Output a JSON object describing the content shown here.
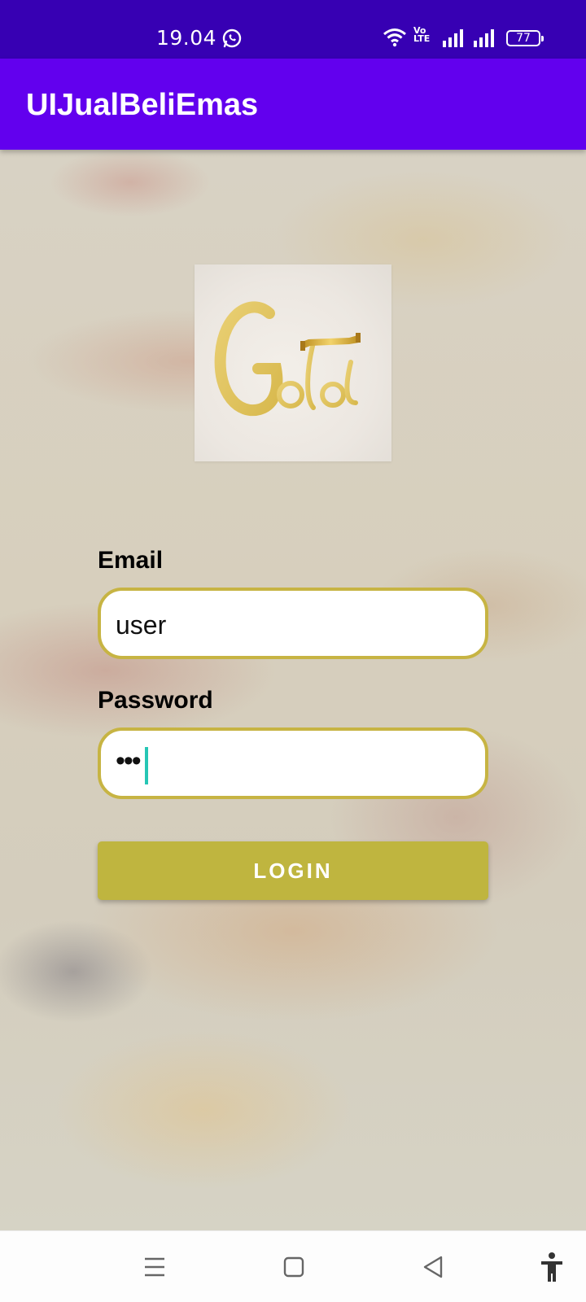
{
  "status_bar": {
    "time": "19.04",
    "volte_top": "Vo",
    "volte_bottom": "LTE",
    "battery": "77",
    "icons": [
      "whatsapp-icon",
      "wifi-icon",
      "volte-icon",
      "signal-icon",
      "signal-icon",
      "battery-icon"
    ]
  },
  "app_bar": {
    "title": "UIJualBeliEmas"
  },
  "logo": {
    "text": "Gold",
    "alt": "Gold logo"
  },
  "form": {
    "email_label": "Email",
    "email_value": "user",
    "password_label": "Password",
    "password_value": "•••",
    "login_label": "LOGIN"
  },
  "nav_bar": {
    "icons": [
      "menu-icon",
      "home-icon",
      "back-icon",
      "accessibility-icon"
    ]
  },
  "colors": {
    "status_bar": "#3700b3",
    "app_bar": "#6200ee",
    "accent_gold": "#bfb53f",
    "field_border": "#c7b443",
    "cursor": "#26c6b5"
  }
}
